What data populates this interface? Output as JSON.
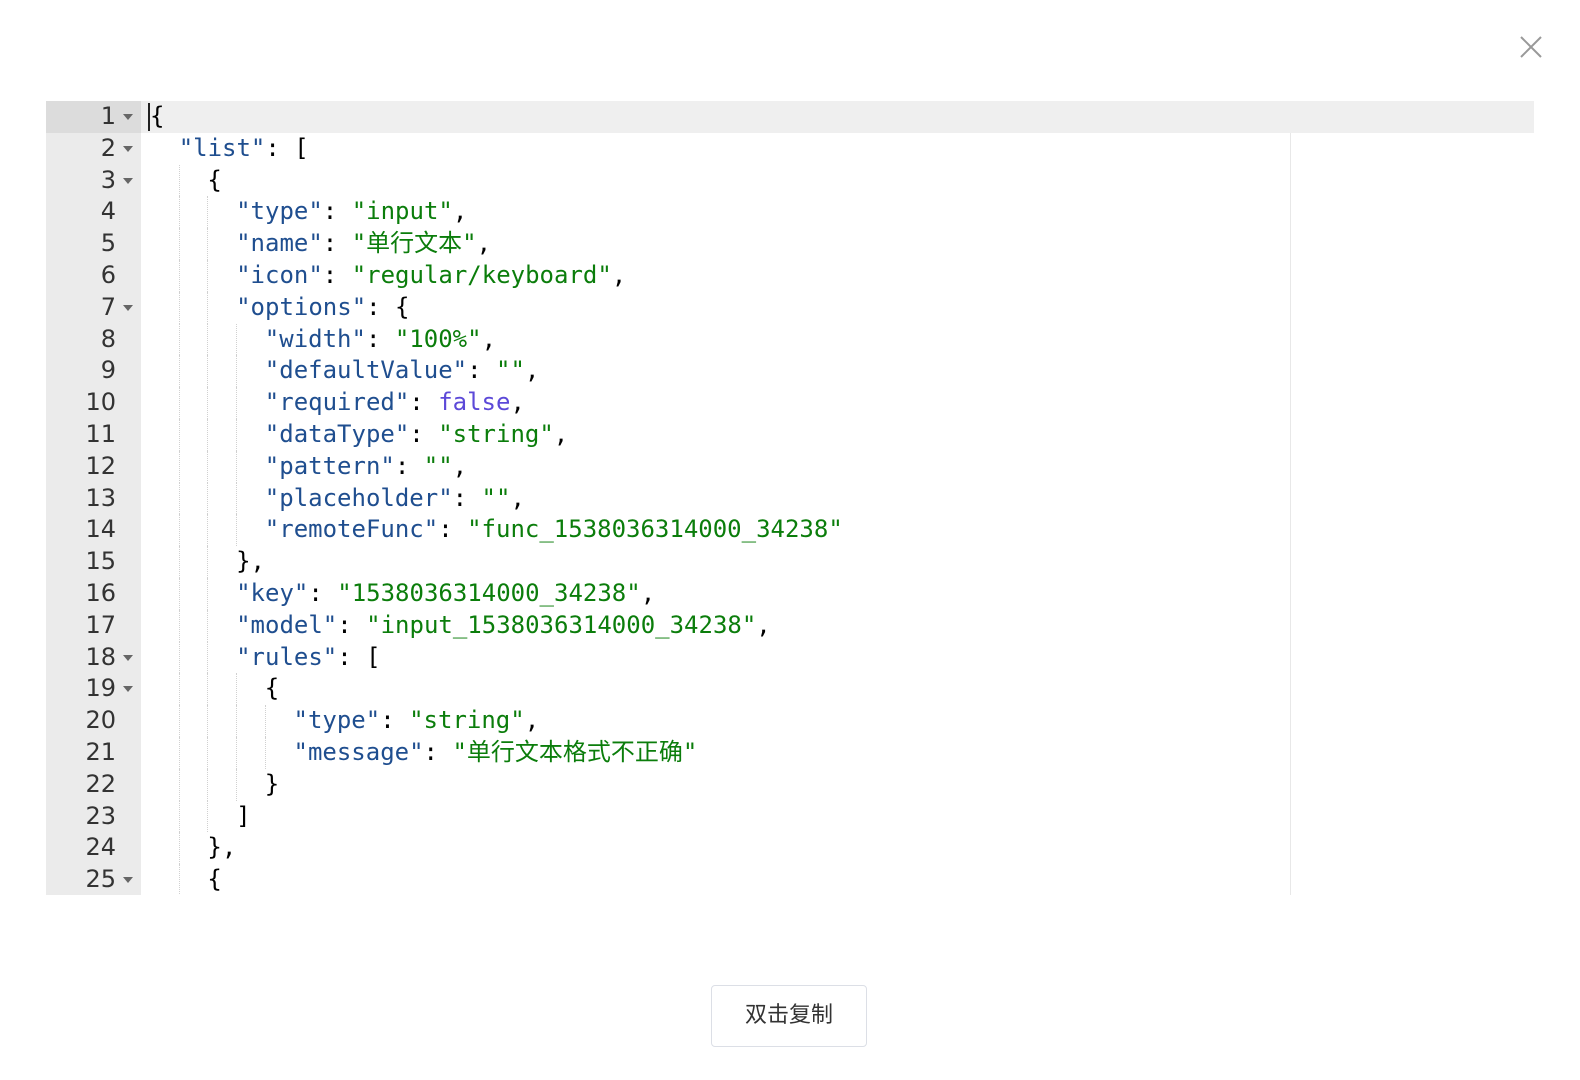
{
  "dialog": {
    "close_icon": "close-icon",
    "copy_button_label": "双击复制"
  },
  "editor": {
    "active_line": 1,
    "lines": [
      {
        "n": "1",
        "fold": true,
        "indent": 0,
        "tokens": [
          [
            "p",
            "{"
          ]
        ]
      },
      {
        "n": "2",
        "fold": true,
        "indent": 1,
        "tokens": [
          [
            "k",
            "\"list\""
          ],
          [
            "p",
            ": ["
          ]
        ]
      },
      {
        "n": "3",
        "fold": true,
        "indent": 2,
        "tokens": [
          [
            "p",
            "{"
          ]
        ]
      },
      {
        "n": "4",
        "fold": false,
        "indent": 3,
        "tokens": [
          [
            "k",
            "\"type\""
          ],
          [
            "p",
            ": "
          ],
          [
            "s",
            "\"input\""
          ],
          [
            "p",
            ","
          ]
        ]
      },
      {
        "n": "5",
        "fold": false,
        "indent": 3,
        "tokens": [
          [
            "k",
            "\"name\""
          ],
          [
            "p",
            ": "
          ],
          [
            "s",
            "\"单行文本\""
          ],
          [
            "p",
            ","
          ]
        ]
      },
      {
        "n": "6",
        "fold": false,
        "indent": 3,
        "tokens": [
          [
            "k",
            "\"icon\""
          ],
          [
            "p",
            ": "
          ],
          [
            "s",
            "\"regular/keyboard\""
          ],
          [
            "p",
            ","
          ]
        ]
      },
      {
        "n": "7",
        "fold": true,
        "indent": 3,
        "tokens": [
          [
            "k",
            "\"options\""
          ],
          [
            "p",
            ": {"
          ]
        ]
      },
      {
        "n": "8",
        "fold": false,
        "indent": 4,
        "tokens": [
          [
            "k",
            "\"width\""
          ],
          [
            "p",
            ": "
          ],
          [
            "s",
            "\"100%\""
          ],
          [
            "p",
            ","
          ]
        ]
      },
      {
        "n": "9",
        "fold": false,
        "indent": 4,
        "tokens": [
          [
            "k",
            "\"defaultValue\""
          ],
          [
            "p",
            ": "
          ],
          [
            "s",
            "\"\""
          ],
          [
            "p",
            ","
          ]
        ]
      },
      {
        "n": "10",
        "fold": false,
        "indent": 4,
        "tokens": [
          [
            "k",
            "\"required\""
          ],
          [
            "p",
            ": "
          ],
          [
            "b",
            "false"
          ],
          [
            "p",
            ","
          ]
        ]
      },
      {
        "n": "11",
        "fold": false,
        "indent": 4,
        "tokens": [
          [
            "k",
            "\"dataType\""
          ],
          [
            "p",
            ": "
          ],
          [
            "s",
            "\"string\""
          ],
          [
            "p",
            ","
          ]
        ]
      },
      {
        "n": "12",
        "fold": false,
        "indent": 4,
        "tokens": [
          [
            "k",
            "\"pattern\""
          ],
          [
            "p",
            ": "
          ],
          [
            "s",
            "\"\""
          ],
          [
            "p",
            ","
          ]
        ]
      },
      {
        "n": "13",
        "fold": false,
        "indent": 4,
        "tokens": [
          [
            "k",
            "\"placeholder\""
          ],
          [
            "p",
            ": "
          ],
          [
            "s",
            "\"\""
          ],
          [
            "p",
            ","
          ]
        ]
      },
      {
        "n": "14",
        "fold": false,
        "indent": 4,
        "tokens": [
          [
            "k",
            "\"remoteFunc\""
          ],
          [
            "p",
            ": "
          ],
          [
            "s",
            "\"func_1538036314000_34238\""
          ]
        ]
      },
      {
        "n": "15",
        "fold": false,
        "indent": 3,
        "tokens": [
          [
            "p",
            "},"
          ]
        ]
      },
      {
        "n": "16",
        "fold": false,
        "indent": 3,
        "tokens": [
          [
            "k",
            "\"key\""
          ],
          [
            "p",
            ": "
          ],
          [
            "s",
            "\"1538036314000_34238\""
          ],
          [
            "p",
            ","
          ]
        ]
      },
      {
        "n": "17",
        "fold": false,
        "indent": 3,
        "tokens": [
          [
            "k",
            "\"model\""
          ],
          [
            "p",
            ": "
          ],
          [
            "s",
            "\"input_1538036314000_34238\""
          ],
          [
            "p",
            ","
          ]
        ]
      },
      {
        "n": "18",
        "fold": true,
        "indent": 3,
        "tokens": [
          [
            "k",
            "\"rules\""
          ],
          [
            "p",
            ": ["
          ]
        ]
      },
      {
        "n": "19",
        "fold": true,
        "indent": 4,
        "tokens": [
          [
            "p",
            "{"
          ]
        ]
      },
      {
        "n": "20",
        "fold": false,
        "indent": 5,
        "tokens": [
          [
            "k",
            "\"type\""
          ],
          [
            "p",
            ": "
          ],
          [
            "s",
            "\"string\""
          ],
          [
            "p",
            ","
          ]
        ]
      },
      {
        "n": "21",
        "fold": false,
        "indent": 5,
        "tokens": [
          [
            "k",
            "\"message\""
          ],
          [
            "p",
            ": "
          ],
          [
            "s",
            "\"单行文本格式不正确\""
          ]
        ]
      },
      {
        "n": "22",
        "fold": false,
        "indent": 4,
        "tokens": [
          [
            "p",
            "}"
          ]
        ]
      },
      {
        "n": "23",
        "fold": false,
        "indent": 3,
        "tokens": [
          [
            "p",
            "]"
          ]
        ]
      },
      {
        "n": "24",
        "fold": false,
        "indent": 2,
        "tokens": [
          [
            "p",
            "},"
          ]
        ]
      },
      {
        "n": "25",
        "fold": true,
        "indent": 2,
        "tokens": [
          [
            "p",
            "{"
          ]
        ]
      }
    ]
  }
}
